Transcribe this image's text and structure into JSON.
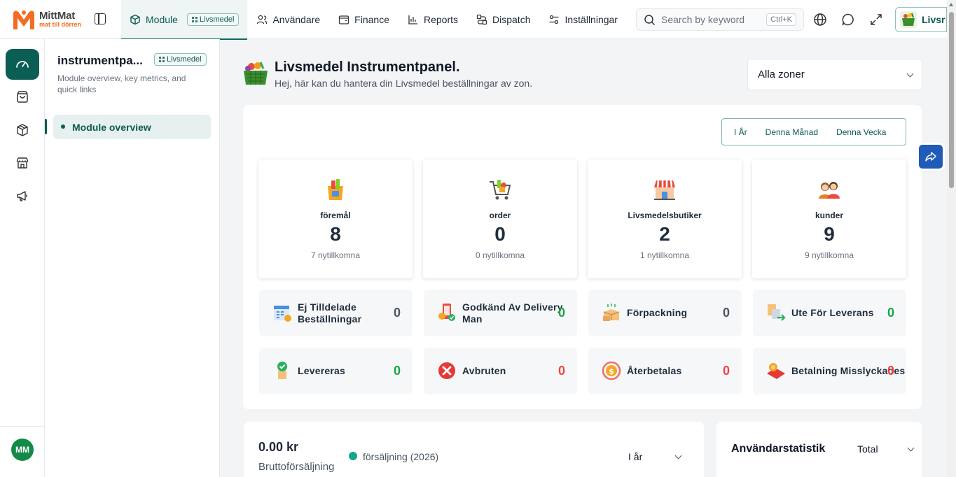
{
  "brand": {
    "name": "MittMat",
    "tagline": "mat till dörren",
    "accent": "#0b5e54",
    "logo_orange": "#f36c21"
  },
  "topnav": {
    "items": [
      {
        "label": "Module",
        "icon": "cube-icon",
        "badge": "Livsmedel"
      },
      {
        "label": "Användare",
        "icon": "users-icon"
      },
      {
        "label": "Finance",
        "icon": "wallet-icon"
      },
      {
        "label": "Reports",
        "icon": "bar-chart-icon"
      },
      {
        "label": "Dispatch",
        "icon": "route-icon"
      },
      {
        "label": "Inställningar",
        "icon": "sliders-icon"
      }
    ],
    "search_placeholder": "Search by keyword",
    "search_shortcut": "Ctrl+K",
    "user_chip_label": "Livsr"
  },
  "subsidebar": {
    "title": "instrumentpa...",
    "badge": "Livsmedel",
    "description": "Module overview, key metrics, and quick links",
    "items": [
      {
        "label": "Module overview"
      }
    ]
  },
  "avatar_initials": "MM",
  "header": {
    "title": "Livsmedel Instrumentpanel.",
    "subtitle": "Hej, här kan du hantera din Livsmedel beställningar av zon.",
    "zone_select": "Alla zoner"
  },
  "period_tabs": [
    "I År",
    "Denna Månad",
    "Denna Vecka"
  ],
  "stats": [
    {
      "label": "föremål",
      "value": "8",
      "new": "7 nytillkomna",
      "icon": "grocery-bag-icon"
    },
    {
      "label": "order",
      "value": "0",
      "new": "0 nytillkomna",
      "icon": "shopping-cart-icon"
    },
    {
      "label": "Livsmedelsbutiker",
      "value": "2",
      "new": "1 nytillkomna",
      "icon": "store-icon"
    },
    {
      "label": "kunder",
      "value": "9",
      "new": "9 nytillkomna",
      "icon": "customers-icon"
    }
  ],
  "status_tiles": [
    {
      "label": "Ej Tilldelade Beställningar",
      "value": "0",
      "color": "#4b5563",
      "icon": "calendar-icon"
    },
    {
      "label": "Godkänd Av Delivery Man",
      "value": "0",
      "color": "#16a34a",
      "icon": "phone-check-icon"
    },
    {
      "label": "Förpackning",
      "value": "0",
      "color": "#4b5563",
      "icon": "package-icon"
    },
    {
      "label": "Ute För Leverans",
      "value": "0",
      "color": "#16a34a",
      "icon": "delivery-icon"
    },
    {
      "label": "Levereras",
      "value": "0",
      "color": "#16a34a",
      "icon": "delivered-icon"
    },
    {
      "label": "Avbruten",
      "value": "0",
      "color": "#ef4444",
      "icon": "cancel-icon"
    },
    {
      "label": "Återbetalas",
      "value": "0",
      "color": "#ef4444",
      "icon": "refund-icon"
    },
    {
      "label": "Betalning Misslyckades",
      "value": "0",
      "color": "#ef4444",
      "icon": "payment-failed-icon"
    }
  ],
  "sales": {
    "amount": "0.00 kr",
    "label": "Bruttoförsäljning",
    "legend": "försäljning (2026)",
    "period": "I år"
  },
  "user_stats": {
    "title": "Användarstatistik",
    "filter": "Total"
  }
}
